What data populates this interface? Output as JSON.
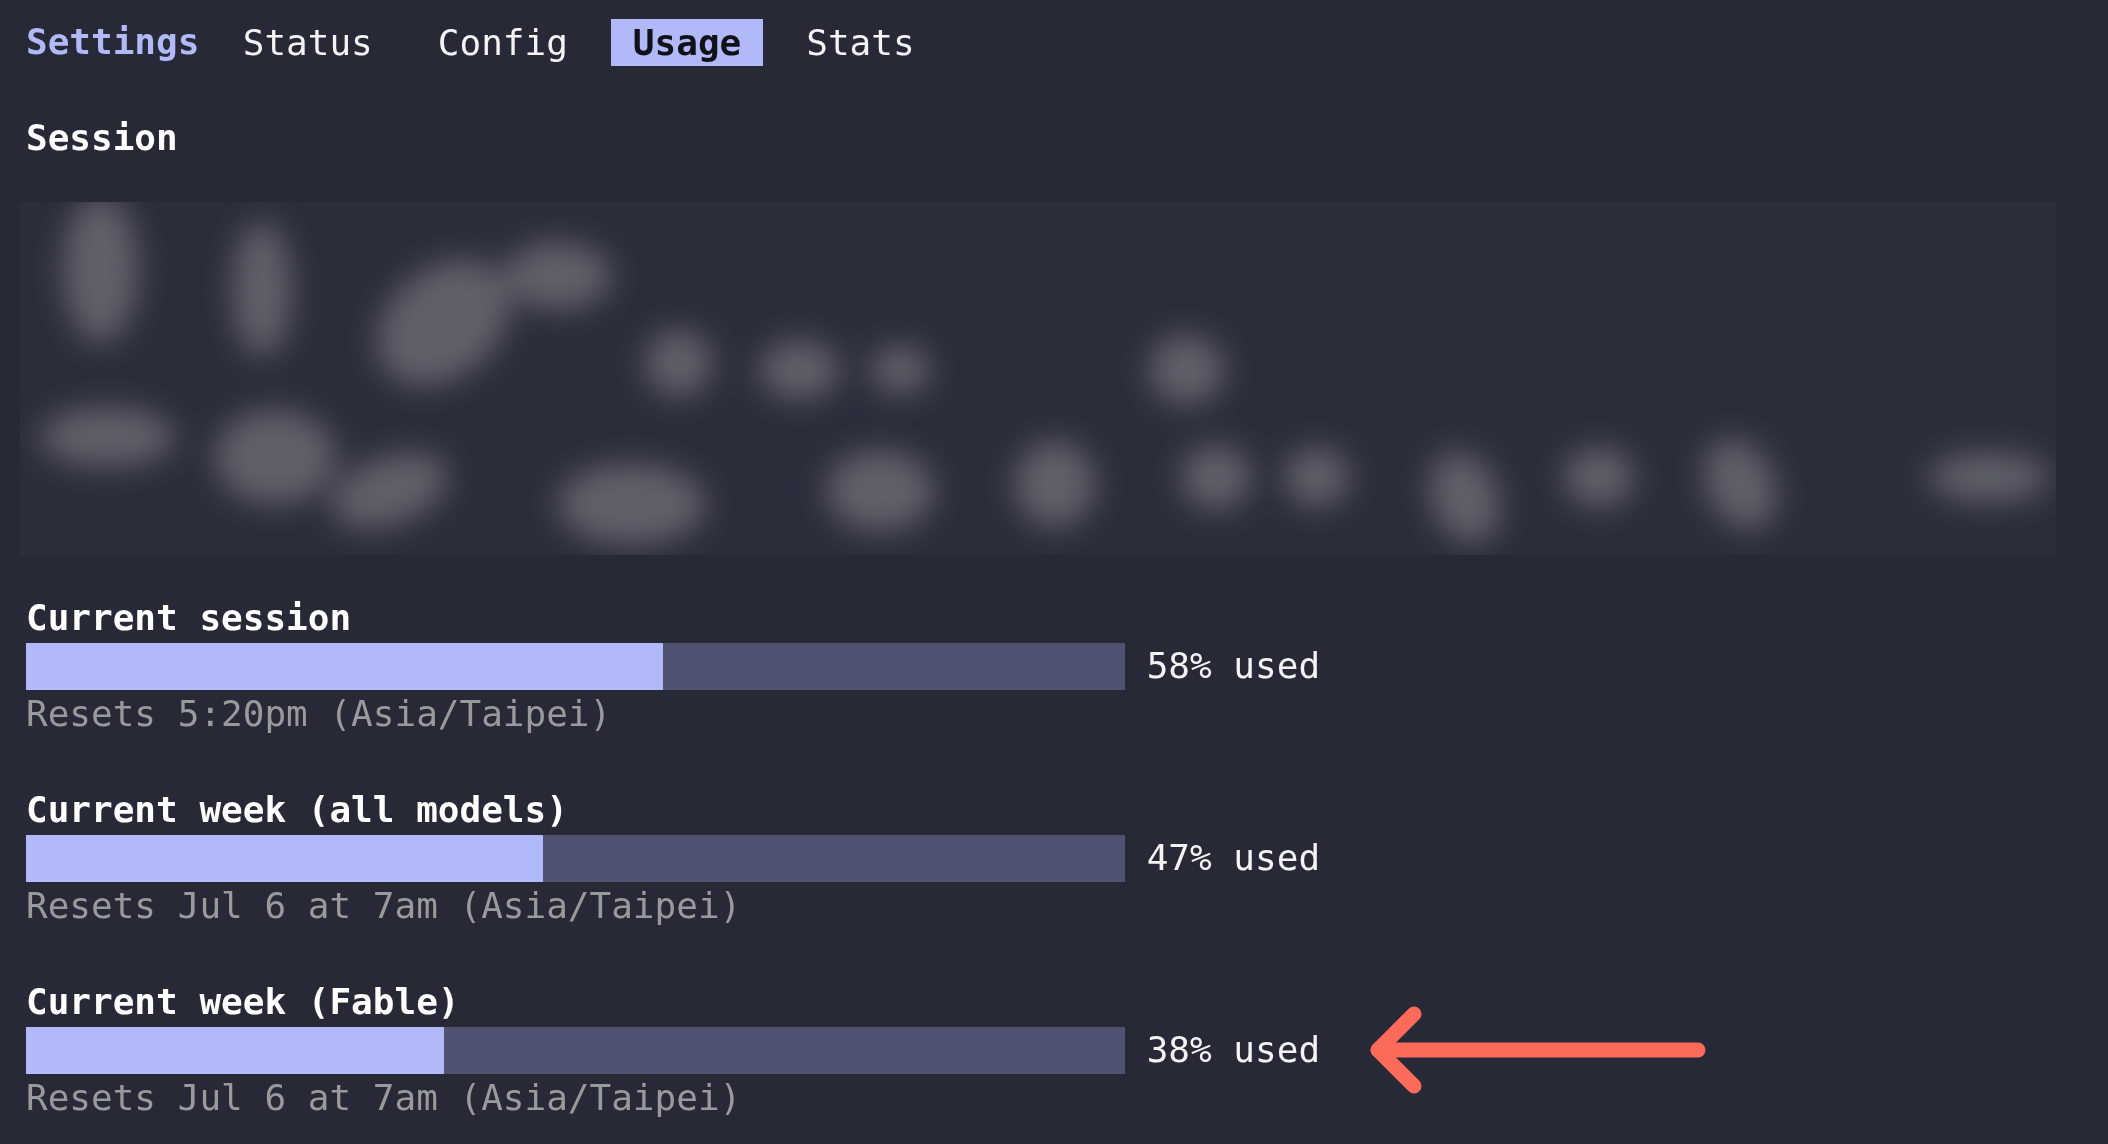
{
  "header": {
    "title": "Settings",
    "tabs": [
      {
        "label": "Status",
        "selected": false
      },
      {
        "label": "Config",
        "selected": false
      },
      {
        "label": "Usage",
        "selected": true
      },
      {
        "label": "Stats",
        "selected": false
      }
    ]
  },
  "session": {
    "title": "Session"
  },
  "limits": [
    {
      "title": "Current session",
      "level": 0.58,
      "reading": "58% used",
      "reset": "Resets 5:20pm (Asia/Taipei)",
      "annotated": false
    },
    {
      "title": "Current week (all models)",
      "level": 0.47,
      "reading": "47% used",
      "reset": "Resets Jul 6 at 7am (Asia/Taipei)",
      "annotated": false
    },
    {
      "title": "Current week (Fable)",
      "level": 0.38,
      "reading": "38% used",
      "reset": "Resets Jul 6 at 7am (Asia/Taipei)",
      "annotated": true
    }
  ]
}
